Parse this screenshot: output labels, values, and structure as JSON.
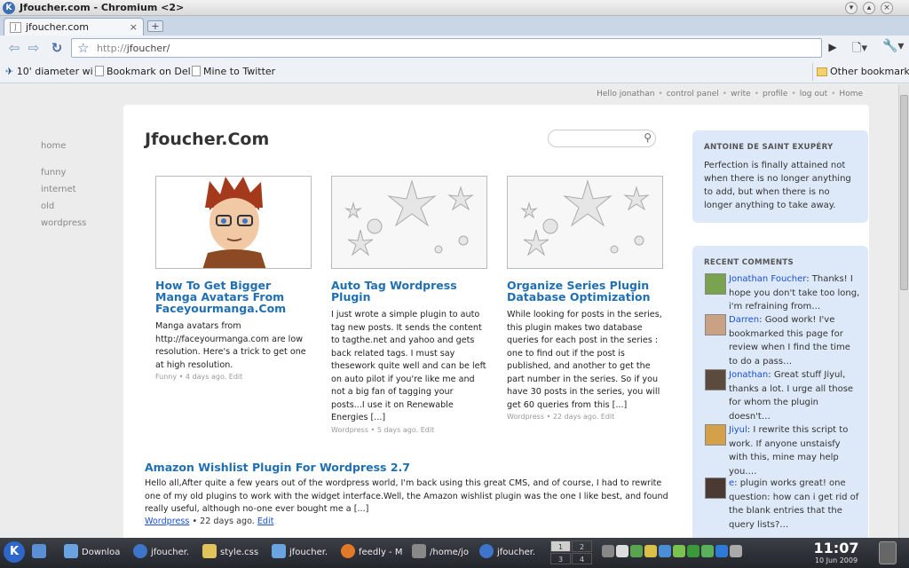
{
  "window": {
    "title": "Jfoucher.com - Chromium <2>"
  },
  "tab": {
    "label": "jfoucher.com",
    "close": "×",
    "new": "+"
  },
  "omnibox": {
    "scheme": "http://",
    "host": "jfoucher/"
  },
  "bookmarks": [
    {
      "label": "10' diameter wi"
    },
    {
      "label": "Bookmark on Del"
    },
    {
      "label": "Mine to Twitter"
    }
  ],
  "other_bookmarks": "Other bookmarks",
  "userbar": [
    "Hello jonathan",
    "control panel",
    "write",
    "profile",
    "log out",
    "Home"
  ],
  "left_nav": {
    "home": "home",
    "items": [
      "funny",
      "internet",
      "old",
      "wordpress"
    ]
  },
  "site_title": "Jfoucher.Com",
  "cards": [
    {
      "title": "How To Get Bigger Manga Avatars From Faceyourmanga.Com",
      "excerpt": "Manga avatars from http://faceyourmanga.com are low resolution. Here's a trick to get one at high resolution.",
      "meta": "Funny • 4 days ago. Edit"
    },
    {
      "title": "Auto Tag Wordpress Plugin",
      "excerpt": "I just wrote a simple plugin to auto tag new posts. It sends the content to tagthe.net and yahoo and gets back related tags. I must say thesework quite well and can be left on auto pilot if you're like me and not a big fan of tagging your posts...I use it on Renewable Energies [...]",
      "meta": "Wordpress • 5 days ago. Edit"
    },
    {
      "title": "Organize Series Plugin Database Optimization",
      "excerpt": "While looking for posts in the series, this plugin makes two database queries for each post in the series : one to find out if the post is published, and another to get the part number in the series. So if you have 30 posts in the series, you will get 60 queries from this [...]",
      "meta": "Wordpress • 22 days ago. Edit"
    }
  ],
  "article": {
    "title": "Amazon Wishlist Plugin For Wordpress 2.7",
    "excerpt": "Hello all,After quite a few years out of the wordpress world, I'm back using this great CMS, and of course, I had to rewrite one of my old plugins to work with the widget interface.Well, the Amazon wishlist plugin was the one I like best, and found really useful, although no-one ever bought me a [...]",
    "category": "Wordpress",
    "date": " • 22 days ago. ",
    "edit": "Edit"
  },
  "quote": {
    "heading": "ANTOINE DE SAINT EXUPÉRY",
    "text": "Perfection is finally attained not when there is no longer anything to add, but when there is no longer anything to take away."
  },
  "recent_comments": {
    "heading": "RECENT COMMENTS",
    "items": [
      {
        "author": "Jonathan Foucher",
        "text": ": Thanks! I hope you don't take too long, i'm refraining from…"
      },
      {
        "author": "Darren",
        "text": ": Good work! I've bookmarked this page for review when I find the time to do a pass…"
      },
      {
        "author": "Jonathan",
        "text": ": Great stuff Jiyul, thanks a lot. I urge all those for whom the plugin doesn't…"
      },
      {
        "author": "Jiyul",
        "text": ": I rewrite this script to work. If anyone unstaisfy with this, mine may help you.…"
      },
      {
        "author": "e",
        "text": ": plugin works great! one question: how can i get rid of the blank entries that the query lists?…"
      }
    ]
  },
  "taskbar": {
    "tasks": [
      "Downloa",
      "jfoucher.",
      "style.css",
      "jfoucher.",
      "feedly - M",
      "/home/jo",
      "jfoucher."
    ],
    "pager": [
      "1",
      "2",
      "3",
      "4"
    ],
    "time": "11:07",
    "date": "10 Jun 2009"
  },
  "colors": {
    "accent": "#1f6fb2",
    "sidebar_bg": "#dde9f8",
    "link": "#1a4fd8"
  }
}
